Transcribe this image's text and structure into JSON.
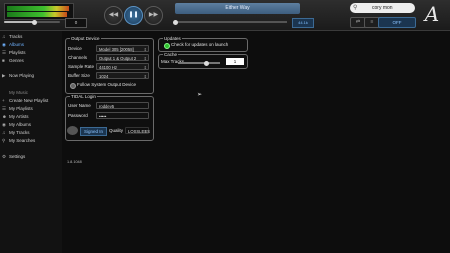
{
  "player": {
    "volume_value": "0",
    "volume_level": 0.55,
    "progress_level": 0.0,
    "track_title": "Either Way",
    "sample_rate": "44.1k",
    "search_value": "cory mon",
    "mode_label": "OFF",
    "logo_letter": "A",
    "icons": {
      "prev": "skip-back-icon",
      "play": "pause-icon",
      "next": "skip-forward-icon",
      "list": "list-icon",
      "search": "search-icon",
      "shuffle": "shuffle-icon",
      "repeat": "repeat-icon"
    }
  },
  "sidebar": {
    "items": [
      {
        "label": "Tracks",
        "icon": "note-icon"
      },
      {
        "label": "Albums",
        "icon": "album-icon",
        "selected": true
      },
      {
        "label": "Playlists",
        "icon": "playlist-icon"
      },
      {
        "label": "Genres",
        "icon": "genre-icon"
      },
      {
        "label": "Now Playing",
        "icon": "now-playing-icon"
      },
      {
        "label": "My Music",
        "icon": ""
      },
      {
        "label": "Create New Playlist",
        "icon": "plus-icon"
      },
      {
        "label": "My Playlists",
        "icon": "playlist-icon"
      },
      {
        "label": "My Artists",
        "icon": "artist-icon"
      },
      {
        "label": "My Albums",
        "icon": "album-icon"
      },
      {
        "label": "My Tracks",
        "icon": "note-icon"
      },
      {
        "label": "My Searches",
        "icon": "search-icon"
      },
      {
        "label": "Settings",
        "icon": "gear-icon"
      }
    ]
  },
  "output_device": {
    "title": "Output Device",
    "device_label": "Device",
    "device_value": "Model 305 [20058]",
    "channels_label": "Channels",
    "channels_value": "Output 1 & Output 2",
    "sample_rate_label": "Sample Rate",
    "sample_rate_value": "44100 Hz",
    "buffer_label": "Buffer Size",
    "buffer_value": "1024",
    "follow_label": "Follow System Output Device"
  },
  "tidal": {
    "title": "TIDAL Login",
    "user_label": "User Name",
    "user_value": "roddev5",
    "password_label": "Password",
    "password_value": "•••••",
    "signin_label": "Signed In",
    "quality_label": "Quality",
    "quality_value": "LOSSLESS"
  },
  "updates": {
    "title": "Updates",
    "check_label": "Check for updates on launch"
  },
  "cache": {
    "title": "Cache",
    "max_tracks_label": "Max Tracks",
    "max_tracks_value": "1"
  },
  "version": "1.8.1048",
  "colors": {
    "accent": "#6fb2ff",
    "track_box": "#4e6f90",
    "check_on": "#2fc02f"
  }
}
